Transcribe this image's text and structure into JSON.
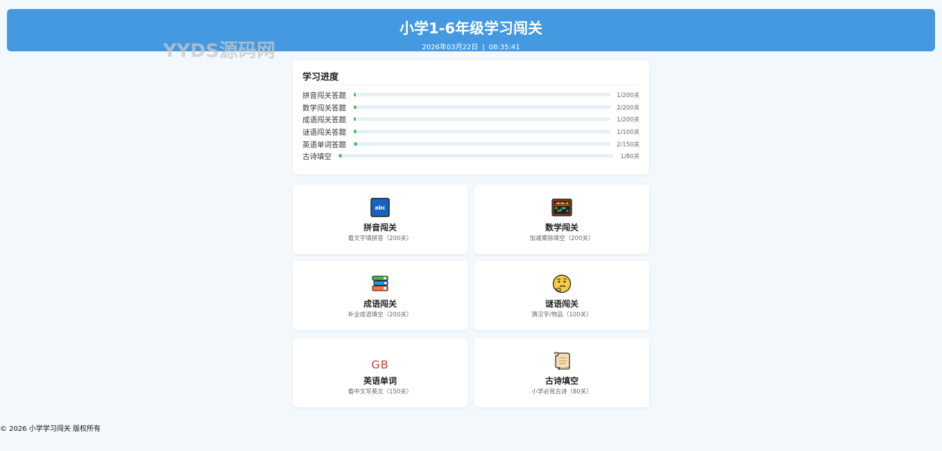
{
  "header": {
    "title": "小学1-6年级学习闯关",
    "date": "2026年03月22日",
    "separator": "|",
    "time": "08:35:41"
  },
  "watermark": "YYDS源码网",
  "progress": {
    "title": "学习进度",
    "items": [
      {
        "label": "拼音闯关答题",
        "count": "1/200关",
        "fraction": 0.005
      },
      {
        "label": "数学闯关答题",
        "count": "2/200关",
        "fraction": 0.01
      },
      {
        "label": "成语闯关答题",
        "count": "1/200关",
        "fraction": 0.005
      },
      {
        "label": "谜语闯关答题",
        "count": "1/100关",
        "fraction": 0.01
      },
      {
        "label": "英语单词答题",
        "count": "2/150关",
        "fraction": 0.013
      },
      {
        "label": "古诗填空",
        "count": "1/80关",
        "fraction": 0.0125
      }
    ]
  },
  "tiles": [
    {
      "name": "拼音闯关",
      "desc": "看文字填拼音（200关）",
      "icon": "abc-icon",
      "icon_text": "abc"
    },
    {
      "name": "数学闯关",
      "desc": "加减乘除填空（200关）",
      "icon": "abacus-icon"
    },
    {
      "name": "成语闯关",
      "desc": "补全成语填空（200关）",
      "icon": "books-icon"
    },
    {
      "name": "谜语闯关",
      "desc": "猜汉字/物品（100关）",
      "icon": "thinking-face-icon"
    },
    {
      "name": "英语单词",
      "desc": "看中文写英文（150关）",
      "icon": "gb-flag-icon",
      "icon_text": "GB"
    },
    {
      "name": "古诗填空",
      "desc": "小学必背古诗（80关）",
      "icon": "scroll-icon"
    }
  ],
  "colors": {
    "header_bg": "#4499e0",
    "progress_fill": "#3ec06a",
    "page_bg": "#f3f8fc",
    "gb_text": "#d9342b"
  },
  "footer": "© 2026 小学学习闯关 版权所有"
}
